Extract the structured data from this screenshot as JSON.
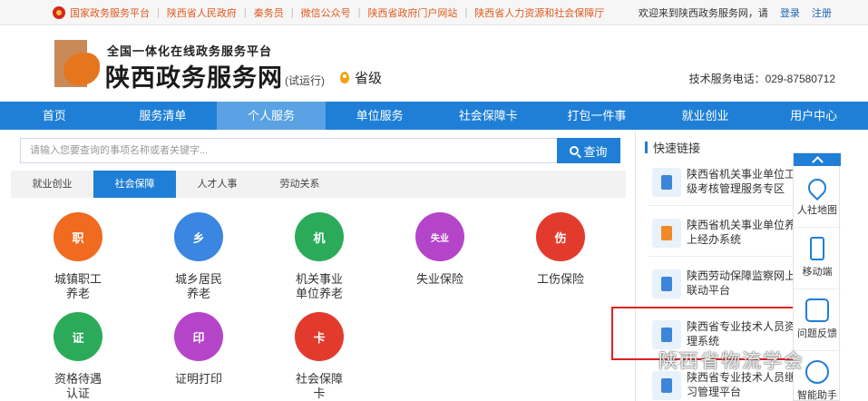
{
  "topbar": {
    "links": [
      "国家政务服务平台",
      "陕西省人民政府",
      "秦务员",
      "微信公众号",
      "陕西省政府门户网站",
      "陕西省人力资源和社会保障厅"
    ],
    "welcome": "欢迎来到陕西政务服务网，请",
    "login": "登录",
    "register": "注册"
  },
  "header": {
    "slogan": "全国一体化在线政务服务平台",
    "site_name": "陕西政务服务网",
    "trial": "(试运行)",
    "level": "省级",
    "hotline": "技术服务电话：029-87580712"
  },
  "nav": {
    "items": [
      "首页",
      "服务清单",
      "个人服务",
      "单位服务",
      "社会保障卡",
      "打包一件事",
      "就业创业",
      "用户中心"
    ],
    "active_index": 2
  },
  "search": {
    "placeholder": "请输入您要查询的事项名称或者关键字...",
    "button": "查询"
  },
  "tabs": {
    "items": [
      "就业创业",
      "社会保障",
      "人才人事",
      "劳动关系"
    ],
    "active_index": 1
  },
  "services": [
    {
      "line1": "城镇职工",
      "line2": "养老",
      "color": "#f06a1f",
      "glyph": "职"
    },
    {
      "line1": "城乡居民",
      "line2": "养老",
      "color": "#3a86e0",
      "glyph": "乡"
    },
    {
      "line1": "机关事业",
      "line2": "单位养老",
      "color": "#2bab5a",
      "glyph": "机"
    },
    {
      "line1": "失业保险",
      "line2": "",
      "color": "#b445c9",
      "glyph": "失业"
    },
    {
      "line1": "工伤保险",
      "line2": "",
      "color": "#e23b2e",
      "glyph": "伤"
    },
    {
      "line1": "资格待遇",
      "line2": "认证",
      "color": "#2bab5a",
      "glyph": "证"
    },
    {
      "line1": "证明打印",
      "line2": "",
      "color": "#b445c9",
      "glyph": "印"
    },
    {
      "line1": "社会保障",
      "line2": "卡",
      "color": "#e23b2e",
      "glyph": "卡"
    }
  ],
  "quick_links": {
    "title": "快速链接",
    "items": [
      {
        "line1": "陕西省机关事业单位工",
        "line2": "级考核管理服务专区",
        "icon": "document-icon"
      },
      {
        "line1": "陕西省机关事业单位养",
        "line2": "上经办系统",
        "icon": "document-icon"
      },
      {
        "line1": "陕西劳动保障监察网上",
        "line2": "联动平台",
        "icon": "shield-icon"
      },
      {
        "line1": "陕西省专业技术人员资",
        "line2": "理系统",
        "icon": "certificate-icon"
      },
      {
        "line1": "陕西省专业技术人员继",
        "line2": "习管理平台",
        "icon": "book-icon"
      }
    ]
  },
  "float_bar": {
    "items": [
      "人社地图",
      "移动端",
      "问题反馈",
      "智能助手"
    ]
  },
  "watermark": "陕西省物流学会"
}
